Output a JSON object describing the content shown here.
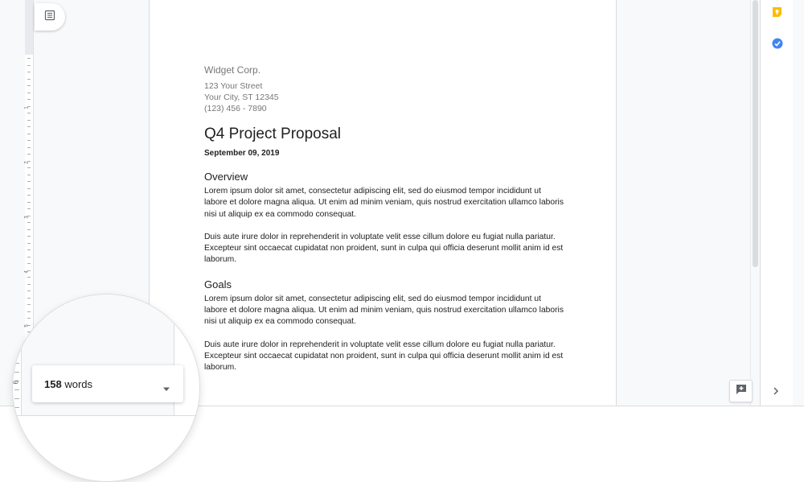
{
  "document": {
    "company": "Widget Corp.",
    "address_lines": [
      "123 Your Street",
      "Your City, ST 12345",
      "(123) 456 - 7890"
    ],
    "title": "Q4 Project Proposal",
    "date": "September 09, 2019",
    "sections": [
      {
        "heading": "Overview",
        "paragraphs": [
          "Lorem ipsum dolor sit amet, consectetur adipiscing elit, sed do eiusmod tempor incididunt ut labore et dolore magna aliqua. Ut enim ad minim veniam, quis nostrud exercitation ullamco laboris nisi ut aliquip ex ea commodo consequat.",
          "Duis aute irure dolor in reprehenderit in voluptate velit esse cillum dolore eu fugiat nulla pariatur. Excepteur sint occaecat cupidatat non proident, sunt in culpa qui officia deserunt mollit anim id est laborum."
        ]
      },
      {
        "heading": "Goals",
        "paragraphs": [
          "Lorem ipsum dolor sit amet, consectetur adipiscing elit, sed do eiusmod tempor incididunt ut labore et dolore magna aliqua. Ut enim ad minim veniam, quis nostrud exercitation ullamco laboris nisi ut aliquip ex ea commodo consequat.",
          "Duis aute irure dolor in reprehenderit in voluptate velit esse cillum dolore eu fugiat nulla pariatur. Excepteur sint occaecat cupidatat non proident, sunt in culpa qui officia deserunt mollit anim id est laborum."
        ]
      }
    ]
  },
  "ruler": {
    "numbers": [
      "1",
      "2",
      "3",
      "4",
      "5"
    ],
    "lens_number": "6"
  },
  "word_count": {
    "count": "158",
    "label": "words"
  },
  "icons": {
    "outline": "document-outline-icon",
    "keep": "keep-icon",
    "tasks": "tasks-icon",
    "add_comment": "add-comment-icon",
    "expand_panel": "chevron-right-icon",
    "word_count_dropdown": "caret-down-icon"
  },
  "colors": {
    "keep": "#fbbc04",
    "tasks": "#4285f4"
  }
}
